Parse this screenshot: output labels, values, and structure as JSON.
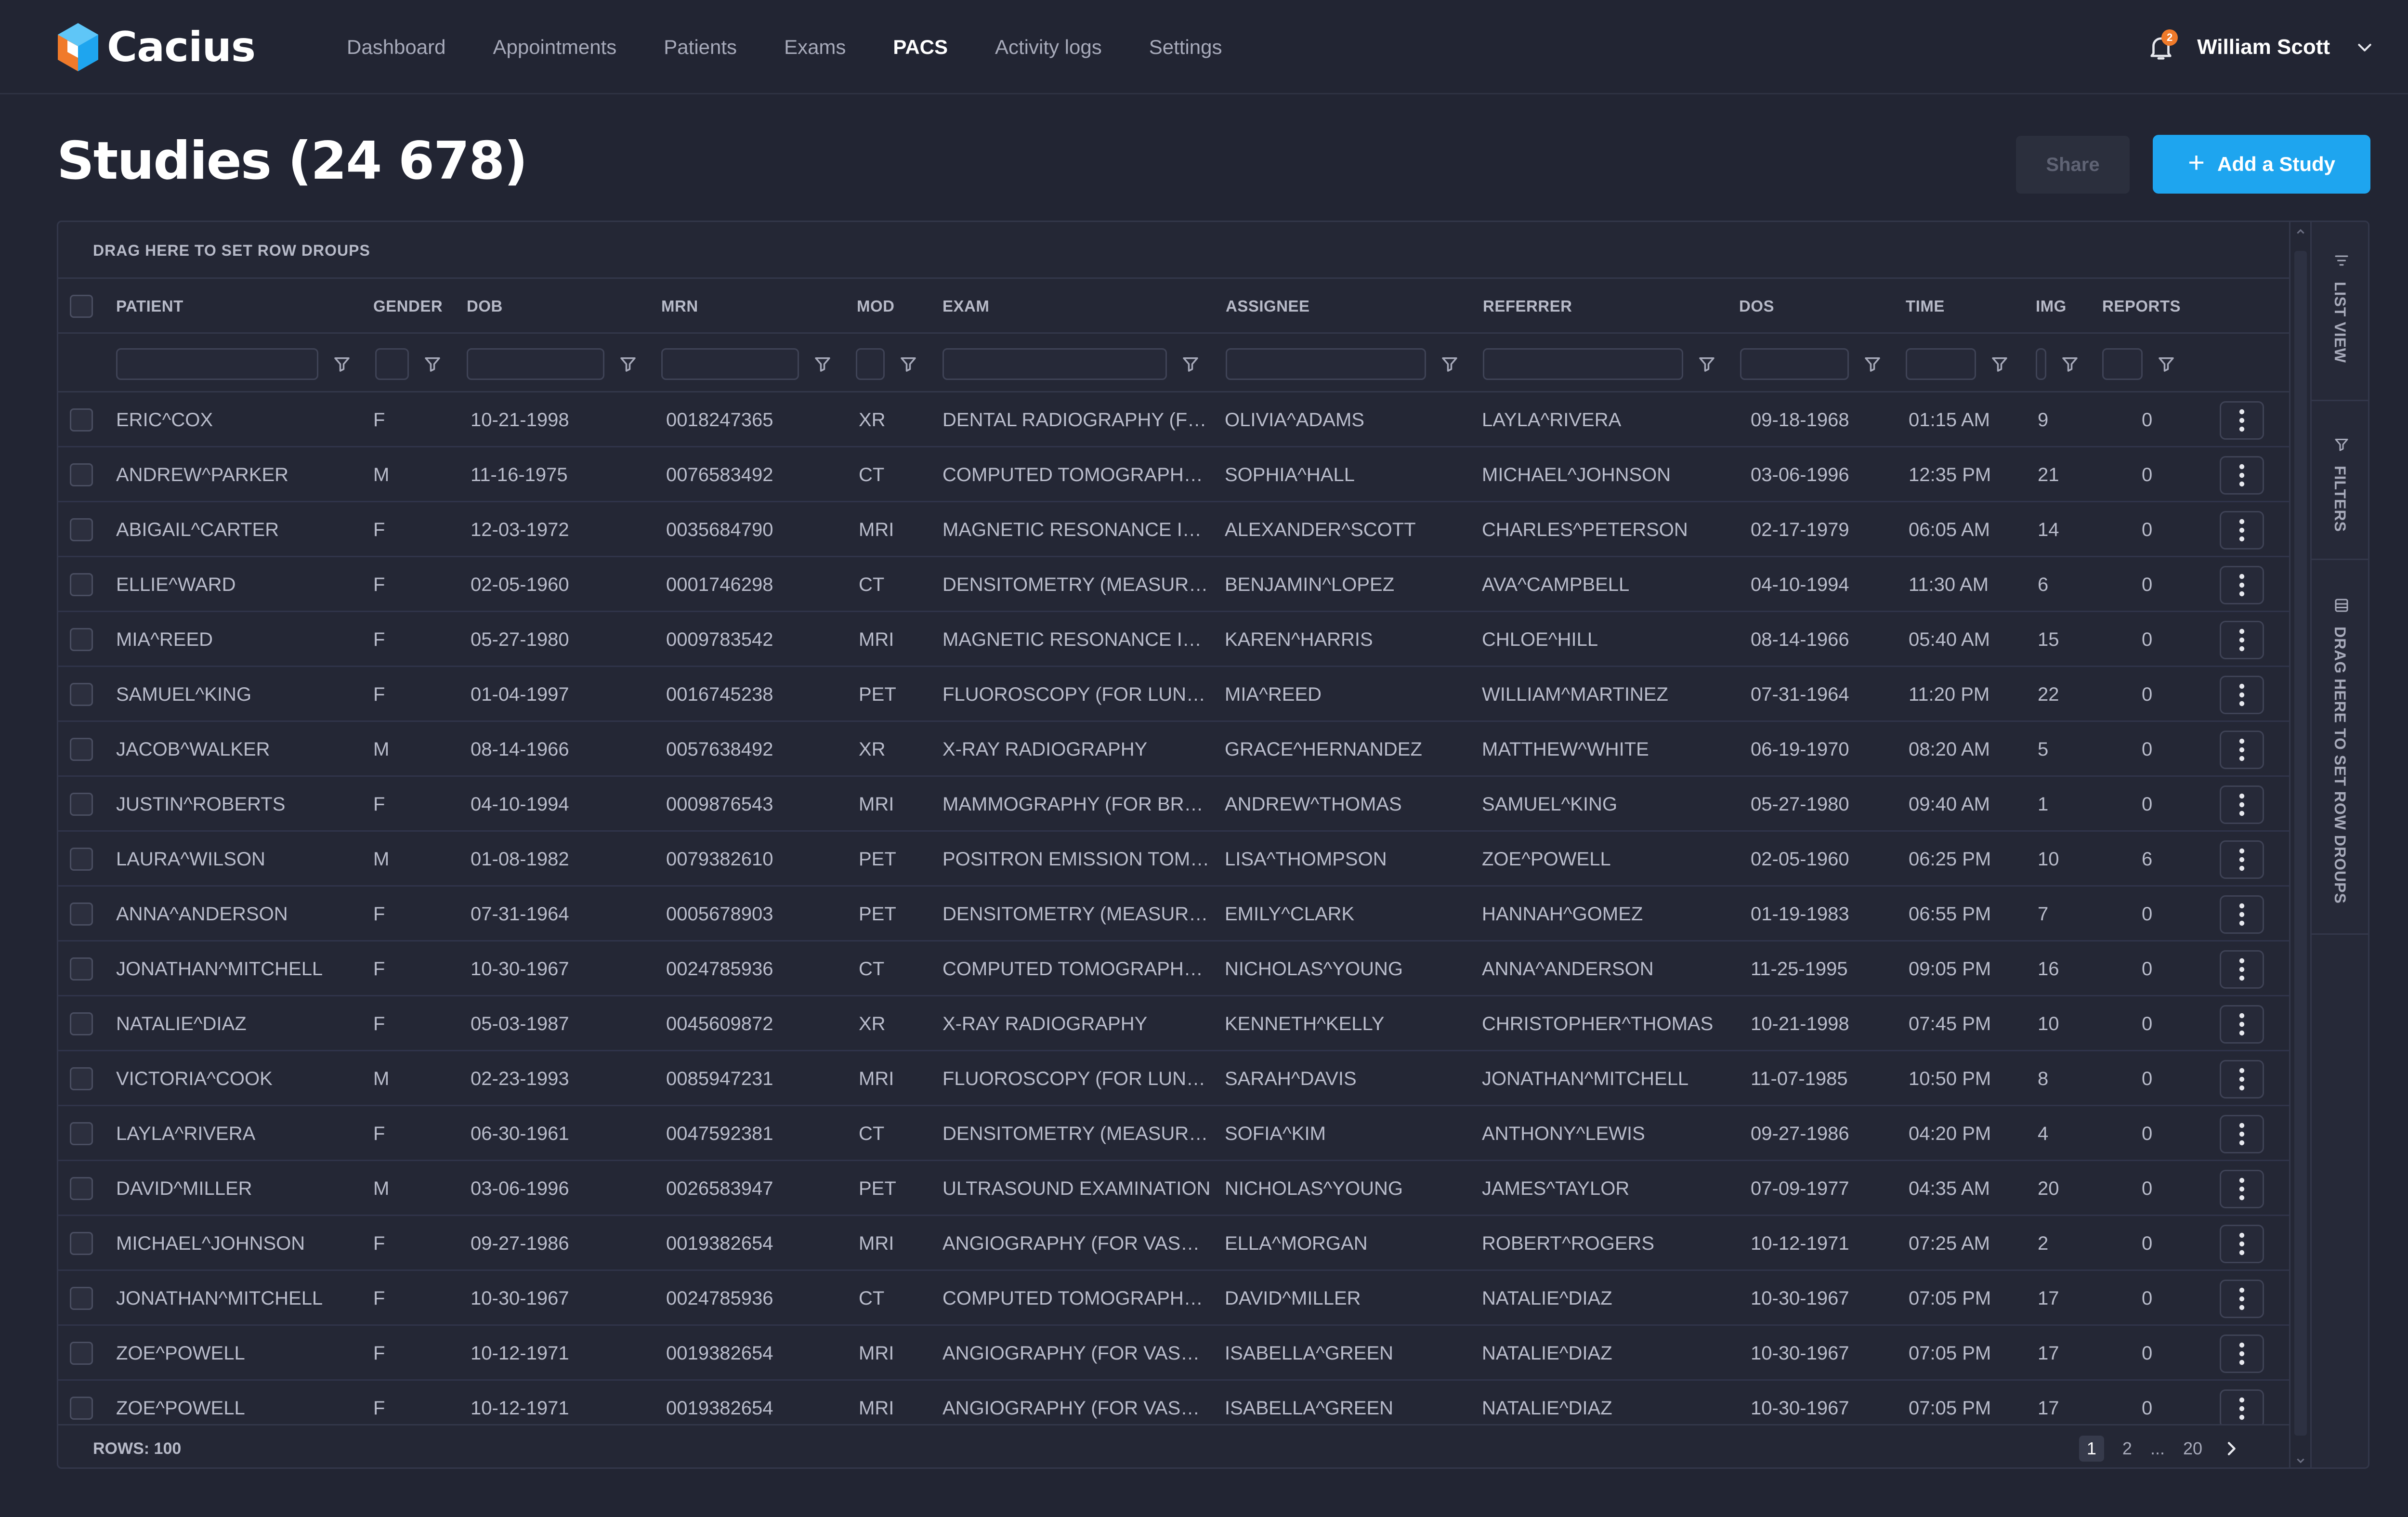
{
  "app": {
    "name": "Cacius"
  },
  "nav": {
    "items": [
      {
        "label": "Dashboard",
        "active": false
      },
      {
        "label": "Appointments",
        "active": false
      },
      {
        "label": "Patients",
        "active": false
      },
      {
        "label": "Exams",
        "active": false
      },
      {
        "label": "PACS",
        "active": true
      },
      {
        "label": "Activity logs",
        "active": false
      },
      {
        "label": "Settings",
        "active": false
      }
    ],
    "notifications_count": "2",
    "user_name": "William Scott"
  },
  "page": {
    "title": "Studies (24 678)",
    "share_label": "Share",
    "add_label": "Add a Study"
  },
  "grid": {
    "group_drop_label": "DRAG HERE TO SET ROW DROUPS",
    "columns": [
      "PATIENT",
      "GENDER",
      "DOB",
      "MRN",
      "MOD",
      "EXAM",
      "ASSIGNEE",
      "REFERRER",
      "DOS",
      "TIME",
      "IMG",
      "REPORTS"
    ],
    "rows": [
      [
        "ERIC^COX",
        "F",
        "10-21-1998",
        "0018247365",
        "XR",
        "DENTAL RADIOGRAPHY (FOR DENTAL EXAMS)",
        "OLIVIA^ADAMS",
        "LAYLA^RIVERA",
        "09-18-1968",
        "01:15 AM",
        "9",
        "0"
      ],
      [
        "ANDREW^PARKER",
        "M",
        "11-16-1975",
        "0076583492",
        "CT",
        "COMPUTED TOMOGRAPHY (CT)",
        "SOPHIA^HALL",
        "MICHAEL^JOHNSON",
        "03-06-1996",
        "12:35 PM",
        "21",
        "0"
      ],
      [
        "ABIGAIL^CARTER",
        "F",
        "12-03-1972",
        "0035684790",
        "MRI",
        "MAGNETIC RESONANCE IMAGING",
        "ALEXANDER^SCOTT",
        "CHARLES^PETERSON",
        "02-17-1979",
        "06:05 AM",
        "14",
        "0"
      ],
      [
        "ELLIE^WARD",
        "F",
        "02-05-1960",
        "0001746298",
        "CT",
        "DENSITOMETRY (MEASUREMENT)",
        "BENJAMIN^LOPEZ",
        "AVA^CAMPBELL",
        "04-10-1994",
        "11:30 AM",
        "6",
        "0"
      ],
      [
        "MIA^REED",
        "F",
        "05-27-1980",
        "0009783542",
        "MRI",
        "MAGNETIC RESONANCE IMAGING",
        "KAREN^HARRIS",
        "CHLOE^HILL",
        "08-14-1966",
        "05:40 AM",
        "15",
        "0"
      ],
      [
        "SAMUEL^KING",
        "F",
        "01-04-1997",
        "0016745238",
        "PET",
        "FLUOROSCOPY (FOR LUNGS)",
        "MIA^REED",
        "WILLIAM^MARTINEZ",
        "07-31-1964",
        "11:20 PM",
        "22",
        "0"
      ],
      [
        "JACOB^WALKER",
        "M",
        "08-14-1966",
        "0057638492",
        "XR",
        "X-RAY RADIOGRAPHY",
        "GRACE^HERNANDEZ",
        "MATTHEW^WHITE",
        "06-19-1970",
        "08:20 AM",
        "5",
        "0"
      ],
      [
        "JUSTIN^ROBERTS",
        "F",
        "04-10-1994",
        "0009876543",
        "MRI",
        "MAMMOGRAPHY (FOR BREAST)",
        "ANDREW^THOMAS",
        "SAMUEL^KING",
        "05-27-1980",
        "09:40 AM",
        "1",
        "0"
      ],
      [
        "LAURA^WILSON",
        "M",
        "01-08-1982",
        "0079382610",
        "PET",
        "POSITRON EMISSION TOMOGRAPHY",
        "LISA^THOMPSON",
        "ZOE^POWELL",
        "02-05-1960",
        "06:25 PM",
        "10",
        "6"
      ],
      [
        "ANNA^ANDERSON",
        "F",
        "07-31-1964",
        "0005678903",
        "PET",
        "DENSITOMETRY (MEASUREMENT)",
        "EMILY^CLARK",
        "HANNAH^GOMEZ",
        "01-19-1983",
        "06:55 PM",
        "7",
        "0"
      ],
      [
        "JONATHAN^MITCHELL",
        "F",
        "10-30-1967",
        "0024785936",
        "CT",
        "COMPUTED TOMOGRAPHY (CT)",
        "NICHOLAS^YOUNG",
        "ANNA^ANDERSON",
        "11-25-1995",
        "09:05 PM",
        "16",
        "0"
      ],
      [
        "NATALIE^DIAZ",
        "F",
        "05-03-1987",
        "0045609872",
        "XR",
        "X-RAY RADIOGRAPHY",
        "KENNETH^KELLY",
        "CHRISTOPHER^THOMAS",
        "10-21-1998",
        "07:45 PM",
        "10",
        "0"
      ],
      [
        "VICTORIA^COOK",
        "M",
        "02-23-1993",
        "0085947231",
        "MRI",
        "FLUOROSCOPY (FOR LUNGS)",
        "SARAH^DAVIS",
        "JONATHAN^MITCHELL",
        "11-07-1985",
        "10:50 PM",
        "8",
        "0"
      ],
      [
        "LAYLA^RIVERA",
        "F",
        "06-30-1961",
        "0047592381",
        "CT",
        "DENSITOMETRY (MEASUREMENT)",
        "SOFIA^KIM",
        "ANTHONY^LEWIS",
        "09-27-1986",
        "04:20 PM",
        "4",
        "0"
      ],
      [
        "DAVID^MILLER",
        "M",
        "03-06-1996",
        "0026583947",
        "PET",
        "ULTRASOUND EXAMINATION",
        "NICHOLAS^YOUNG",
        "JAMES^TAYLOR",
        "07-09-1977",
        "04:35 AM",
        "20",
        "0"
      ],
      [
        "MICHAEL^JOHNSON",
        "F",
        "09-27-1986",
        "0019382654",
        "MRI",
        "ANGIOGRAPHY (FOR VASCULAR)",
        "ELLA^MORGAN",
        "ROBERT^ROGERS",
        "10-12-1971",
        "07:25 AM",
        "2",
        "0"
      ],
      [
        "JONATHAN^MITCHELL",
        "F",
        "10-30-1967",
        "0024785936",
        "CT",
        "COMPUTED TOMOGRAPHY (CT)",
        "DAVID^MILLER",
        "NATALIE^DIAZ",
        "10-30-1967",
        "07:05 PM",
        "17",
        "0"
      ],
      [
        "ZOE^POWELL",
        "F",
        "10-12-1971",
        "0019382654",
        "MRI",
        "ANGIOGRAPHY (FOR VASCULAR)",
        "ISABELLA^GREEN",
        "NATALIE^DIAZ",
        "10-30-1967",
        "07:05 PM",
        "17",
        "0"
      ],
      [
        "ZOE^POWELL",
        "F",
        "10-12-1971",
        "0019382654",
        "MRI",
        "ANGIOGRAPHY (FOR VASCULAR)",
        "ISABELLA^GREEN",
        "NATALIE^DIAZ",
        "10-30-1967",
        "07:05 PM",
        "17",
        "0"
      ]
    ],
    "rows_label": "ROWS: 100",
    "pager": [
      "1",
      "2",
      "...",
      "20"
    ]
  },
  "side_panel": {
    "list_view": "LIST VIEW",
    "filters": "FILTERS",
    "row_groups": "DRAG HERE TO SET ROW DROUPS"
  },
  "icons": {
    "logo": "cacius-logo-icon",
    "bell": "bell-icon",
    "chevron": "chevron-down-icon",
    "filter": "filter-icon",
    "kebab": "kebab-menu-icon"
  },
  "colors": {
    "background": "#222533",
    "accent": "#1ea5ef",
    "logo_orange": "#f07a2a",
    "logo_blue": "#1ea5ef"
  }
}
